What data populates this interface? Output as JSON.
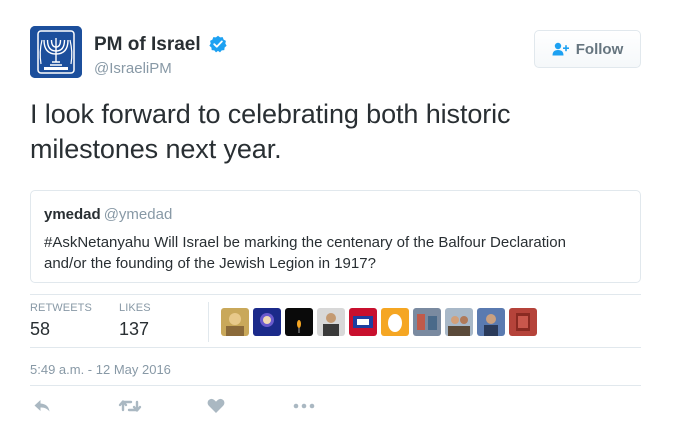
{
  "author": {
    "display_name": "PM of Israel",
    "screen_name": "@IsraeliPM",
    "verified": true,
    "avatar_icon": "israel-emblem-icon"
  },
  "follow_button": {
    "label": "Follow",
    "icon": "add-user-icon"
  },
  "tweet": {
    "text": "I look forward to celebrating both historic milestones next year."
  },
  "quoted_tweet": {
    "name": "ymedad",
    "handle": "@ymedad",
    "text": "#AskNetanyahu Will Israel be marking the centenary of the Balfour Declaration and/or the founding of the Jewish Legion in 1917?"
  },
  "stats": {
    "retweets_label": "RETWEETS",
    "retweets_count": "58",
    "likes_label": "LIKES",
    "likes_count": "137"
  },
  "timestamp": "5:49 a.m. - 12 May 2016",
  "actions": [
    "reply-icon",
    "retweet-icon",
    "like-icon",
    "more-icon"
  ],
  "colors": {
    "text": "#292f33",
    "muted": "#8899a6",
    "border": "#e1e8ed",
    "verified": "#1da1f2",
    "action_icon": "#aab8c2"
  }
}
